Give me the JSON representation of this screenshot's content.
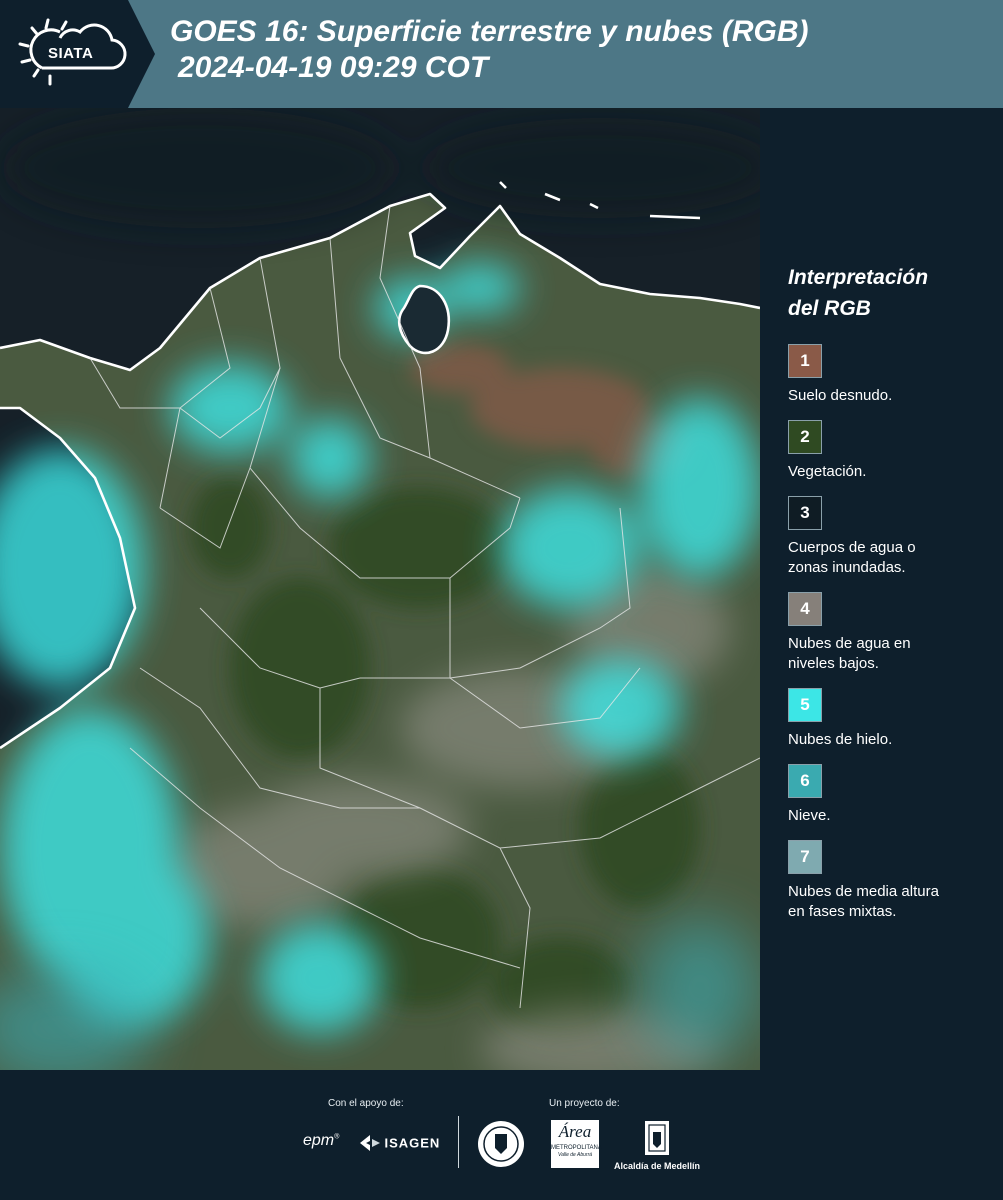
{
  "header": {
    "logo_text": "SIATA",
    "title_line1": "GOES 16: Superficie terrestre y nubes (RGB)",
    "title_line2": "2024-04-19 09:29 COT"
  },
  "legend": {
    "title_line1": "Interpretación",
    "title_line2": "del RGB",
    "items": [
      {
        "number": "1",
        "color": "#8a5a48",
        "label_lines": [
          "Suelo desnudo."
        ]
      },
      {
        "number": "2",
        "color": "#2f4a22",
        "label_lines": [
          "Vegetación."
        ]
      },
      {
        "number": "3",
        "color": "#0f1c24",
        "label_lines": [
          "Cuerpos de agua o",
          "zonas inundadas."
        ]
      },
      {
        "number": "4",
        "color": "#86807a",
        "label_lines": [
          "Nubes de agua en",
          "niveles bajos."
        ]
      },
      {
        "number": "5",
        "color": "#3ce6e6",
        "label_lines": [
          "Nubes de hielo."
        ]
      },
      {
        "number": "6",
        "color": "#3aaab0",
        "label_lines": [
          "Nieve."
        ]
      },
      {
        "number": "7",
        "color": "#7faab0",
        "label_lines": [
          "Nubes de media altura",
          "en fases mixtas."
        ]
      }
    ]
  },
  "footer": {
    "support_caption": "Con el apoyo de:",
    "project_caption": "Un proyecto de:",
    "sponsors": [
      "epm",
      "ISAGEN"
    ],
    "partners": {
      "area_name": "Área",
      "area_sub1": "METROPOLITANA",
      "area_sub2": "Valle de Aburrá",
      "alcaldia": "Alcaldía de Medellín"
    }
  },
  "colors": {
    "header_bg": "#4d7786",
    "logo_bg": "#0e1f2c",
    "panel_bg": "#0e1f2c",
    "ice_cloud": "#3ce6e6",
    "vegetation": "#2f4a22",
    "water": "#0f1c24",
    "coastline": "#ffffff"
  }
}
